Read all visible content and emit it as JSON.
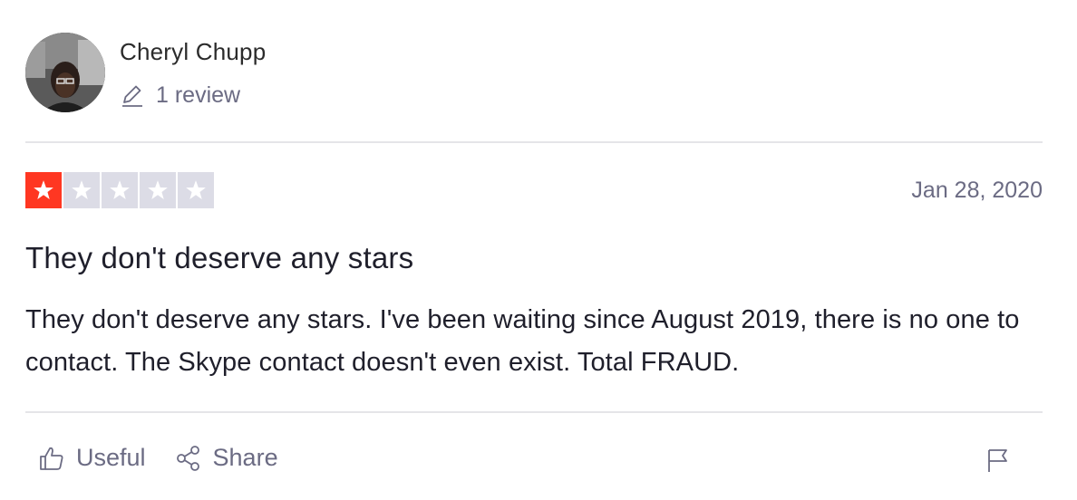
{
  "reviewer": {
    "name": "Cheryl Chupp",
    "review_count": "1 review"
  },
  "review": {
    "rating": 1,
    "max_rating": 5,
    "date": "Jan 28, 2020",
    "title": "They don't deserve any stars",
    "body": "They don't deserve any stars. I've been waiting since August 2019, there is no one to contact. The Skype contact doesn't even exist. Total FRAUD."
  },
  "actions": {
    "useful_label": "Useful",
    "share_label": "Share"
  },
  "icons": {
    "pencil": "pencil-icon",
    "star": "star-icon",
    "thumbs_up": "thumbs-up-icon",
    "share": "share-icon",
    "flag": "flag-icon"
  },
  "colors": {
    "star_filled": "#ff3722",
    "star_empty": "#dcdce6",
    "muted_text": "#6b6b83",
    "divider": "#e5e5e8"
  }
}
